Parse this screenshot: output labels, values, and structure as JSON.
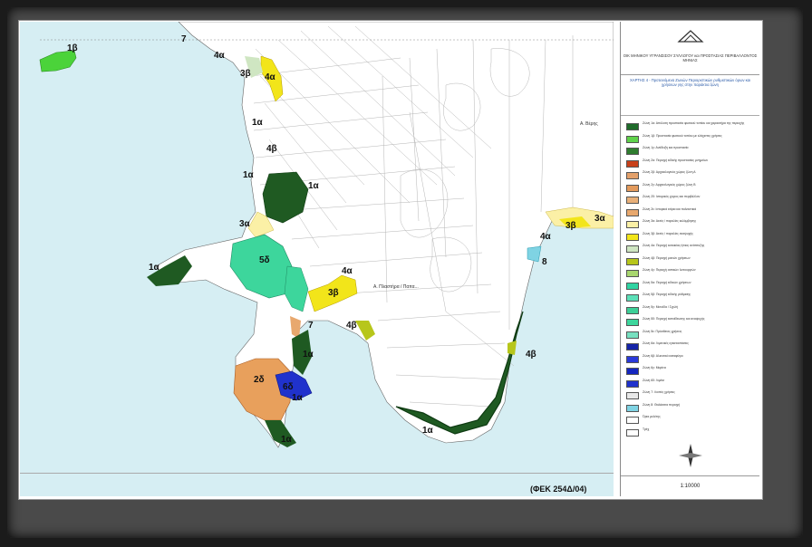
{
  "map": {
    "reference": "(ΦΕΚ 254Δ/04)",
    "place_labels": [
      "Α. Βέρης",
      "Α. Πλαστήρα / Παπα..."
    ],
    "zone_labels": [
      "1β",
      "7",
      "4α",
      "3β",
      "4α",
      "1α",
      "4β",
      "1α",
      "1α",
      "3α",
      "5δ",
      "1α",
      "4α",
      "3β",
      "7",
      "4β",
      "1α",
      "2δ",
      "6δ",
      "1α",
      "1α",
      "3β",
      "3α",
      "4α",
      "8",
      "4β",
      "1α"
    ]
  },
  "legend": {
    "org": "ΟΙΚ ΜΗΝΙΚΟΥ ΥΓΡΑΝΣΙΣΟΥ ΣΥΛΛΟΓΟΥ και ΠΡΟΣΤΑΣΙΑΣ ΠΕΡΙΒΑΛΛΟΝΤΟΣ ΜΗΝΙΑΣ",
    "title": "ΧΑΡΤΗΣ 4 - Προτεινόμενα Ζωνών Περιοριστικών ρυθμιστικών όρων και χρήσεων γης στην παράκτια ζώνη",
    "scale": "1:10000",
    "items": [
      {
        "color": "#1f6b2a",
        "text": "Ζώνη 1α: Απόλυτη προστασία φυσικού τοπίου και χαρακτήρα της περιοχής"
      },
      {
        "color": "#5fd24b",
        "text": "Ζώνη 1β: Προστασία φυσικού τοπίου με ελάχιστες χρήσεις"
      },
      {
        "color": "#2f7d2f",
        "text": "Ζώνη 1γ: Ανάδειξη και προστασία"
      },
      {
        "color": "#c8401a",
        "text": "Ζώνη 2α: Περιοχή ειδικής προστασίας μνημείων"
      },
      {
        "color": "#e3a06a",
        "text": "Ζώνη 2β: Αρχαιολογικός χώρος ζώνη Α"
      },
      {
        "color": "#e39a5c",
        "text": "Ζώνη 2γ: Αρχαιολογικός χώρος ζώνη Β"
      },
      {
        "color": "#e8b07a",
        "text": "Ζώνη 2δ: Ιστορικός χώρος και περιβάλλον"
      },
      {
        "color": "#e8a86e",
        "text": "Ζώνη 2ε: Ιστορικά κτίρια και πολιτιστικά"
      },
      {
        "color": "#fbf0a6",
        "text": "Ζώνη 3α: Ακτές / παραλίες κολύμβησης"
      },
      {
        "color": "#f2e51a",
        "text": "Ζώνη 3β: Ακτές / παραλίες αναψυχής"
      },
      {
        "color": "#cfe6c2",
        "text": "Ζώνη 4α: Περιοχή κατοικίας ήπιας ανάπτυξης"
      },
      {
        "color": "#b7c61b",
        "text": "Ζώνη 4β: Περιοχή μικτών χρήσεων"
      },
      {
        "color": "#a8d66e",
        "text": "Ζώνη 4γ: Περιοχή αστικών λειτουργιών"
      },
      {
        "color": "#2fd3a2",
        "text": "Ζώνη 5α: Περιοχή ειδικών χρήσεων"
      },
      {
        "color": "#5ce0b8",
        "text": "Ζώνη 5β: Περιοχή ειδικής ρύθμισης"
      },
      {
        "color": "#3dcf97",
        "text": "Ζώνη 5γ: Μονάδα / Σχολή"
      },
      {
        "color": "#3dd69c",
        "text": "Ζώνη 5δ: Περιοχή εκπαίδευσης και αναψυχής"
      },
      {
        "color": "#77e0c0",
        "text": "Ζώνη 5ε: Πρόσθετες χρήσεις"
      },
      {
        "color": "#1524a8",
        "text": "Ζώνη 6α: Λιμενικές εγκαταστάσεις"
      },
      {
        "color": "#2a39d9",
        "text": "Ζώνη 6β: Αλιευτικό καταφύγιο"
      },
      {
        "color": "#1526c0",
        "text": "Ζώνη 6γ: Μαρίνα"
      },
      {
        "color": "#2032cc",
        "text": "Ζώνη 6δ: Λιμάνι"
      },
      {
        "color": "#e8e8e8",
        "text": "Ζώνη 7: Λοιπές χρήσεις"
      },
      {
        "color": "#7fd3e3",
        "text": "Ζώνη 8: Θαλάσσια περιοχή"
      },
      {
        "color": "#ffffff",
        "text": "Όρια μελέτης"
      },
      {
        "color": "#ffffff",
        "text": "Τρέχ"
      }
    ]
  }
}
